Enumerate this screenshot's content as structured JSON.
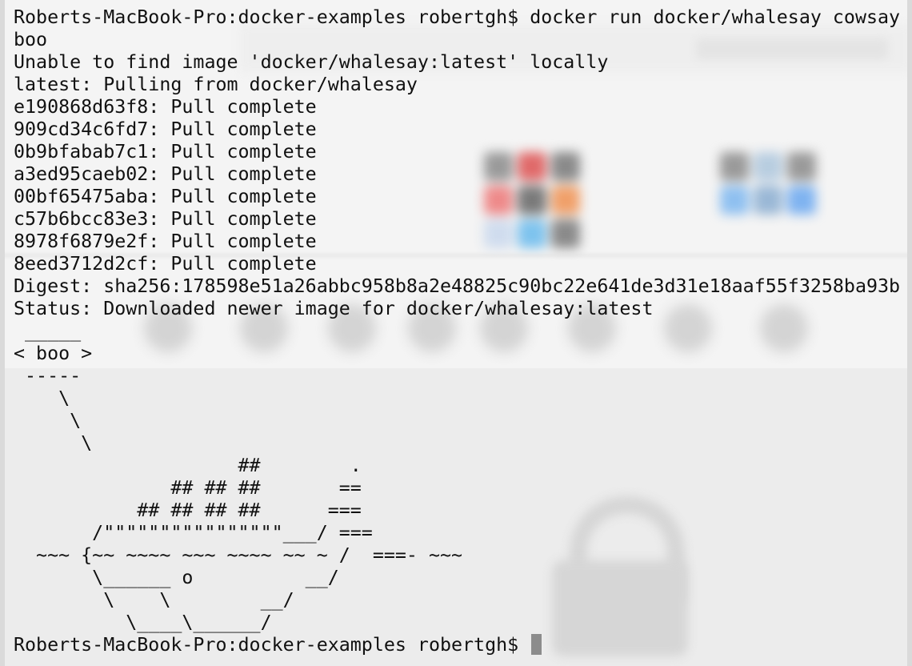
{
  "terminal": {
    "lines": [
      "Roberts-MacBook-Pro:docker-examples robertgh$ docker run docker/whalesay cowsay",
      "boo",
      "Unable to find image 'docker/whalesay:latest' locally",
      "latest: Pulling from docker/whalesay",
      "e190868d63f8: Pull complete",
      "909cd34c6fd7: Pull complete",
      "0b9bfabab7c1: Pull complete",
      "a3ed95caeb02: Pull complete",
      "00bf65475aba: Pull complete",
      "c57b6bcc83e3: Pull complete",
      "8978f6879e2f: Pull complete",
      "8eed3712d2cf: Pull complete",
      "Digest: sha256:178598e51a26abbc958b8a2e48825c90bc22e641de3d31e18aaf55f3258ba93b",
      "Status: Downloaded newer image for docker/whalesay:latest",
      " _____",
      "< boo >",
      " -----",
      "    \\",
      "     \\",
      "      \\",
      "                    ##        .",
      "              ## ## ##       ==",
      "           ## ## ## ##      ===",
      "       /\"\"\"\"\"\"\"\"\"\"\"\"\"\"\"\"___/ ===",
      "  ~~~ {~~ ~~~~ ~~~ ~~~~ ~~ ~ /  ===- ~~~",
      "       \\______ o          __/",
      "        \\    \\        __/",
      "          \\____\\______/"
    ],
    "prompt": "Roberts-MacBook-Pro:docker-examples robertgh$ "
  }
}
